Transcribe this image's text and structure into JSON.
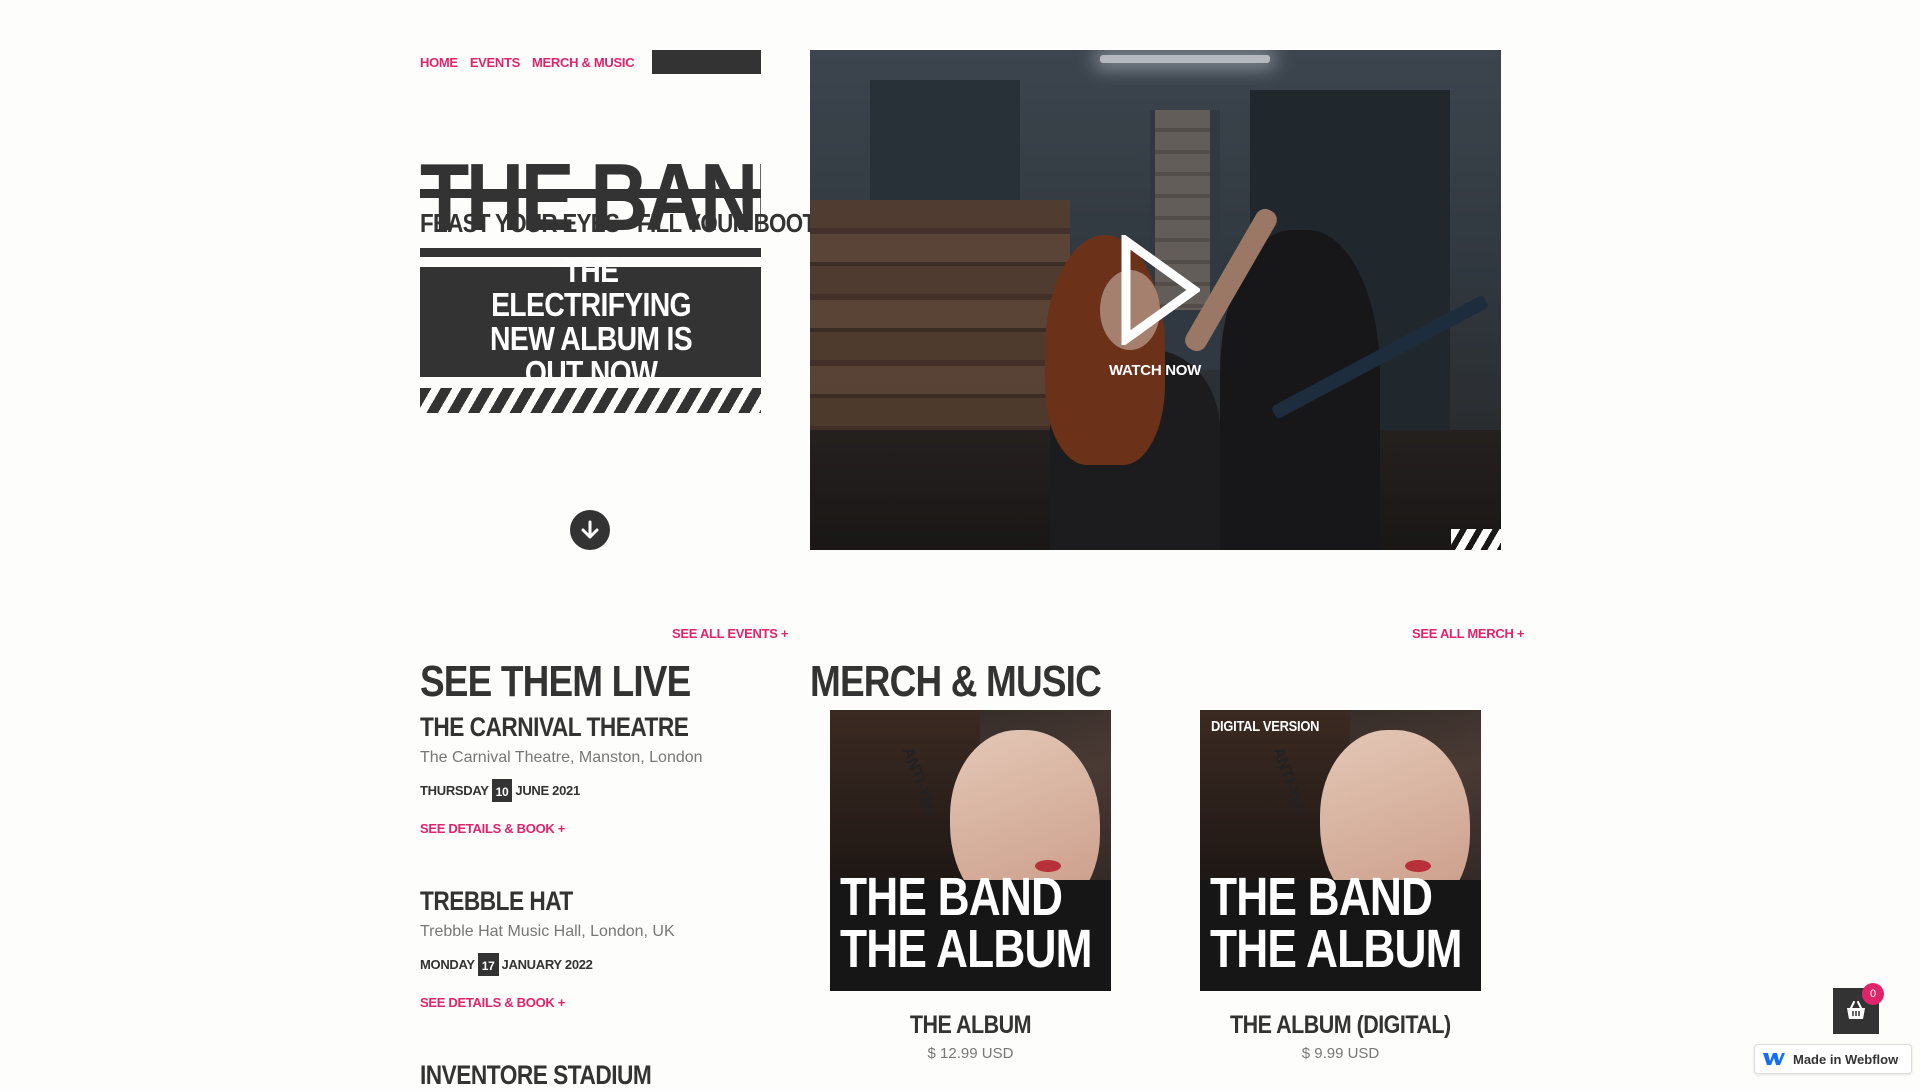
{
  "nav": {
    "items": [
      "HOME",
      "EVENTS",
      "MERCH & MUSIC"
    ]
  },
  "hero": {
    "title": "THE BAND",
    "tagline": "FEAST YOUR EYES · FILL YOUR BOOTS",
    "cta": "THE ELECTRIFYING NEW ALBUM IS OUT NOW",
    "scroll_icon": "arrow-down-circle-icon"
  },
  "video": {
    "label": "WATCH NOW",
    "icon": "play-icon"
  },
  "events": {
    "heading": "SEE THEM LIVE",
    "see_all": "SEE ALL EVENTS +",
    "items": [
      {
        "venue": "THE CARNIVAL THEATRE",
        "address": "The Carnival Theatre, Manston, London",
        "weekday": "THURSDAY",
        "day": "10",
        "month_year": "JUNE 2021",
        "link": "SEE DETAILS & BOOK +"
      },
      {
        "venue": "TREBBLE HAT",
        "address": "Trebble Hat Music Hall, London, UK",
        "weekday": "MONDAY",
        "day": "17",
        "month_year": "JANUARY 2022",
        "link": "SEE DETAILS & BOOK +"
      },
      {
        "venue": "INVENTORE STADIUM"
      }
    ]
  },
  "merch": {
    "heading": "MERCH & MUSIC",
    "see_all": "SEE ALL MERCH +",
    "products": [
      {
        "cover_line1": "THE BAND",
        "cover_line2": "THE ALBUM",
        "neck_text": "ANTI-You",
        "name": "THE ALBUM",
        "price": "$ 12.99 USD"
      },
      {
        "badge": "DIGITAL VERSION",
        "cover_line1": "THE BAND",
        "cover_line2": "THE ALBUM",
        "neck_text": "ANTI-You",
        "name": "THE ALBUM (DIGITAL)",
        "price": "$ 9.99 USD"
      }
    ]
  },
  "cart": {
    "count": "0",
    "icon": "basket-icon"
  },
  "webflow_badge": {
    "label": "Made in Webflow",
    "icon": "webflow-logo-icon"
  },
  "colors": {
    "accent": "#e0246c",
    "dark": "#333333",
    "background": "#fdfdfb"
  }
}
